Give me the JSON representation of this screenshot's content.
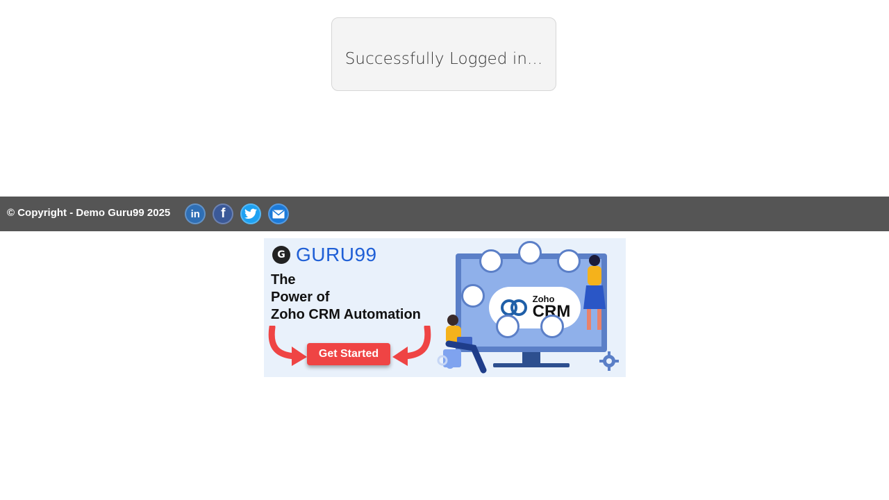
{
  "status": {
    "message": "Successfully Logged in..."
  },
  "footer": {
    "copyright": "© Copyright - Demo Guru99 2025",
    "socials": [
      {
        "name": "linkedin",
        "icon": "linkedin-icon",
        "glyph": "in",
        "color": "#2f6fb5"
      },
      {
        "name": "facebook",
        "icon": "facebook-icon",
        "glyph": "f",
        "color": "#3b5998"
      },
      {
        "name": "twitter",
        "icon": "twitter-icon",
        "color": "#1da1f2"
      },
      {
        "name": "email",
        "icon": "email-icon",
        "color": "#1c7ad8"
      }
    ],
    "background": "#555555"
  },
  "banner": {
    "logo_text": "GURU99",
    "headline_lines": [
      "The",
      "Power of",
      "Zoho CRM Automation"
    ],
    "cta_label": "Get Started",
    "crm_small": "Zoho",
    "crm_big": "CRM",
    "cta_color": "#ef4444"
  }
}
